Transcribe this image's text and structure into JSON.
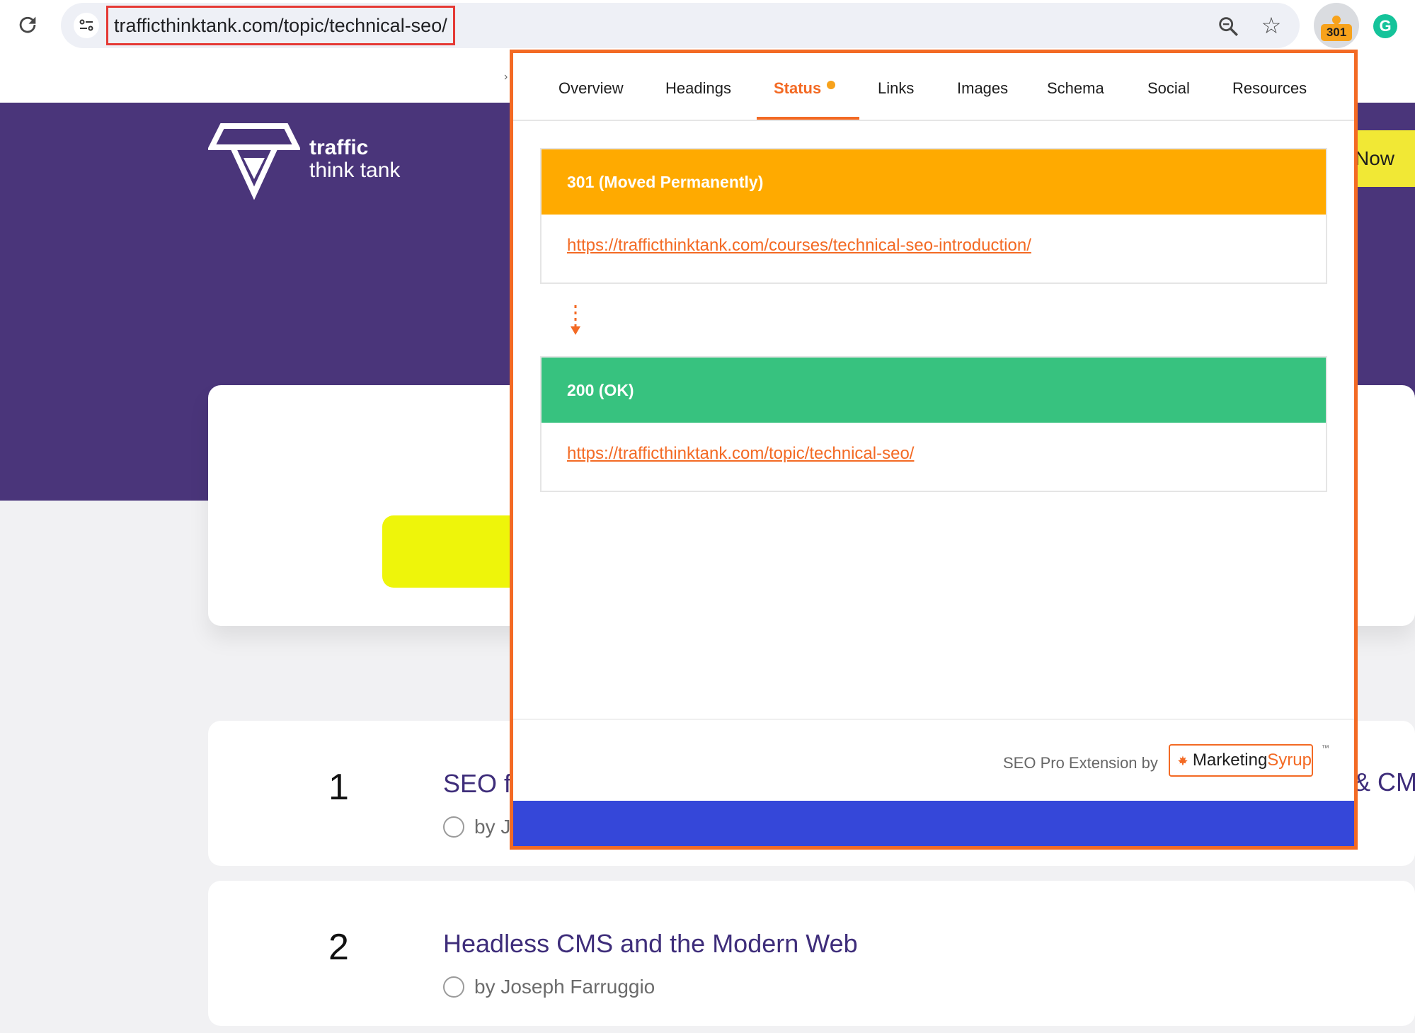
{
  "browser": {
    "url": "trafficthinktank.com/topic/technical-seo/",
    "extension_badge": "301"
  },
  "website": {
    "logo_line1": "traffic",
    "logo_line2": "think tank",
    "cta_partial": "Now",
    "items": [
      {
        "number": "1",
        "title_partial": "SEO f",
        "author_partial": "by J",
        "title_right_partial": "& CM"
      },
      {
        "number": "2",
        "title": "Headless CMS and the Modern Web",
        "author": "by Joseph Farruggio"
      }
    ]
  },
  "popup": {
    "tabs": [
      {
        "label": "Overview"
      },
      {
        "label": "Headings"
      },
      {
        "label": "Status",
        "active": true
      },
      {
        "label": "Links"
      },
      {
        "label": "Images"
      },
      {
        "label": "Schema"
      },
      {
        "label": "Social"
      },
      {
        "label": "Resources"
      }
    ],
    "statuses": [
      {
        "code": "301 (Moved Permanently)",
        "url": "https://trafficthinktank.com/courses/technical-seo-introduction/",
        "color": "#ffaa00"
      },
      {
        "code": "200 (OK)",
        "url": "https://trafficthinktank.com/topic/technical-seo/",
        "color": "#37c27f"
      }
    ],
    "footer": {
      "text": "SEO Pro Extension by",
      "brand_part1": "Marketing",
      "brand_part2": "Syrup",
      "trademark": "™"
    },
    "accent_color": "#f36a24"
  }
}
